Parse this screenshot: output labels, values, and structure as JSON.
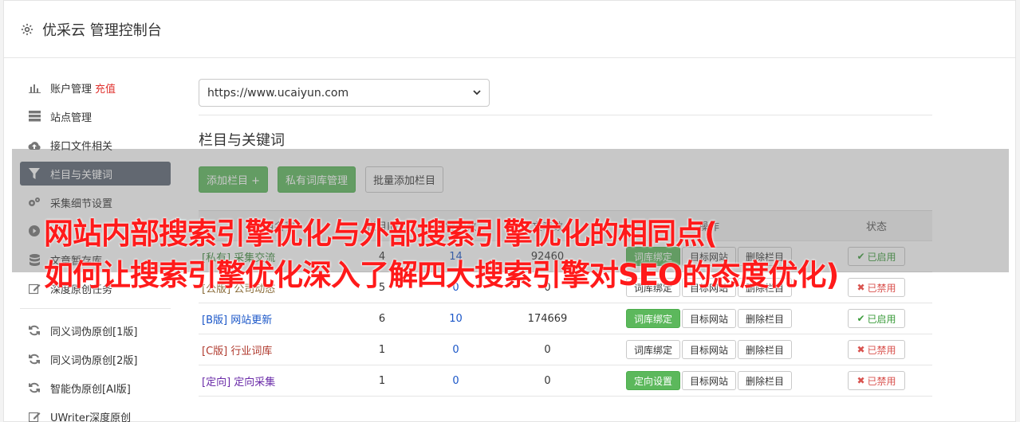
{
  "header": {
    "title": "优采云 管理控制台",
    "icon": "gear-icon"
  },
  "sidebar": {
    "items": [
      {
        "label": "账户管理",
        "extra": "充值",
        "icon": "bar-chart-icon"
      },
      {
        "label": "站点管理",
        "icon": "server-icon"
      },
      {
        "label": "接口文件相关",
        "icon": "cloud-upload-icon"
      },
      {
        "label": "栏目与关键词",
        "icon": "filter-icon",
        "active": true
      },
      {
        "label": "采集细节设置",
        "icon": "cogs-icon"
      },
      {
        "label": "",
        "icon": "play-circle-icon"
      },
      {
        "label": "文章暂存库",
        "icon": "database-icon"
      },
      {
        "label": "深度原创任务",
        "icon": "edit-icon"
      }
    ],
    "items2": [
      {
        "label": "同义词伪原创[1版]",
        "icon": "refresh-icon"
      },
      {
        "label": "同义词伪原创[2版]",
        "icon": "refresh-icon"
      },
      {
        "label": "智能伪原创[AI版]",
        "icon": "refresh-icon"
      },
      {
        "label": "UWriter深度原创",
        "icon": "edit-icon"
      }
    ]
  },
  "site_select": {
    "value": "https://www.ucaiyun.com"
  },
  "section": {
    "title": "栏目与关键词"
  },
  "toolbar": {
    "add_column": "添加栏目 +",
    "private_lib": "私有词库管理",
    "batch_add": "批量添加栏目"
  },
  "table": {
    "headers": [
      "栏目名称",
      "栏目ID",
      "关键词数",
      "文章数",
      "操作",
      "状态"
    ],
    "rows": [
      {
        "tag": "[私有]",
        "name": "采集交流",
        "id": "4",
        "kw": "14",
        "articles": "92460",
        "btn1": "词库绑定",
        "btn2": "目标网站",
        "btn3": "删除栏目",
        "status": "已启用",
        "on": true,
        "cls": "c-private",
        "btn1green": true
      },
      {
        "tag": "[公版]",
        "name": "公司动态",
        "id": "5",
        "kw": "0",
        "articles": "0",
        "btn1": "词库绑定",
        "btn2": "目标网站",
        "btn3": "删除栏目",
        "status": "已禁用",
        "on": false,
        "cls": "c-public",
        "btn1green": false
      },
      {
        "tag": "[B版]",
        "name": "网站更新",
        "id": "6",
        "kw": "10",
        "articles": "174669",
        "btn1": "词库绑定",
        "btn2": "目标网站",
        "btn3": "删除栏目",
        "status": "已启用",
        "on": true,
        "cls": "c-b",
        "btn1green": true
      },
      {
        "tag": "[C版]",
        "name": "行业词库",
        "id": "1",
        "kw": "0",
        "articles": "0",
        "btn1": "词库绑定",
        "btn2": "目标网站",
        "btn3": "删除栏目",
        "status": "已禁用",
        "on": false,
        "cls": "c-c",
        "btn1green": false
      },
      {
        "tag": "[定向]",
        "name": "定向采集",
        "id": "1",
        "kw": "0",
        "articles": "0",
        "btn1": "定向设置",
        "btn2": "目标网站",
        "btn3": "删除栏目",
        "status": "已禁用",
        "on": false,
        "cls": "c-dir",
        "btn1green": true
      }
    ]
  },
  "overlay": {
    "line1": "网站内部搜索引擎优化与外部搜索引擎优化的相同点(",
    "line2": "如何让搜索引擎优化深入了解四大搜索引擎对SEO的态度优化)"
  },
  "colors": {
    "accent_green": "#5cb85c",
    "active_nav": "#5b6573",
    "overlay_text": "#ff1a1a",
    "danger": "#d9534f"
  }
}
